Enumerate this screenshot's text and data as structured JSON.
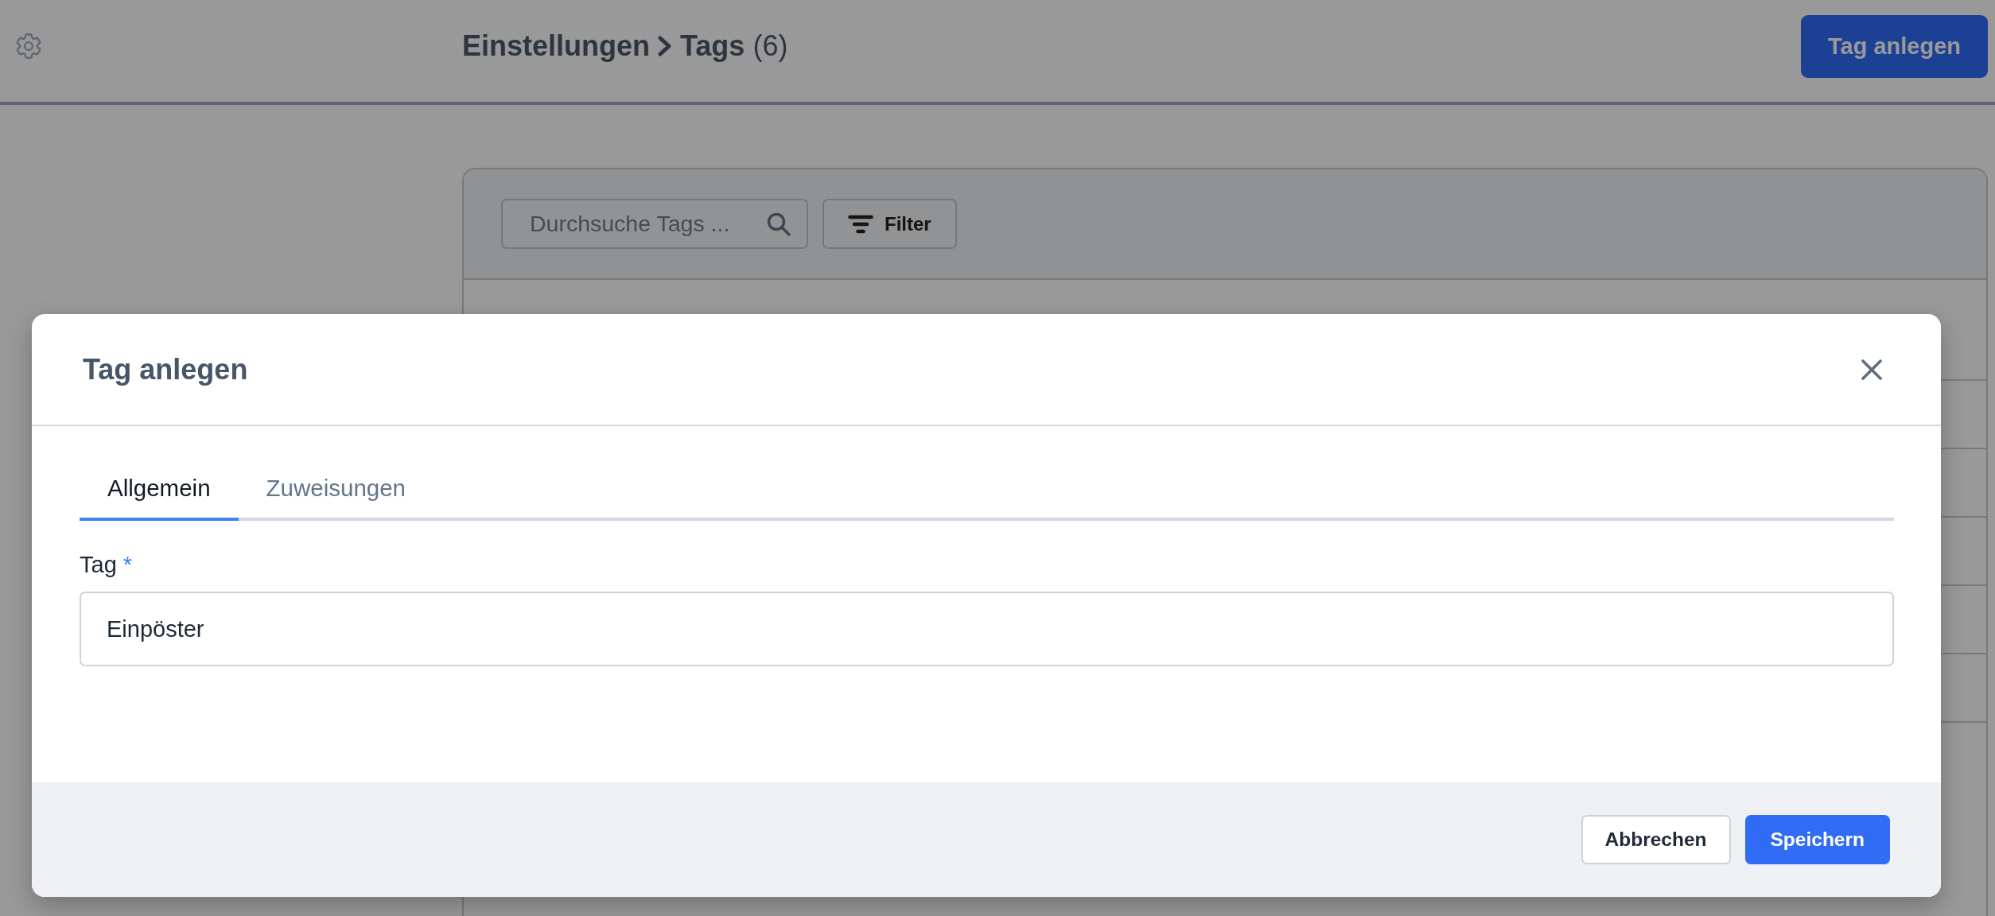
{
  "header": {
    "breadcrumb": [
      {
        "label": "Einstellungen"
      },
      {
        "label": "Tags"
      }
    ],
    "count": "(6)",
    "action_button": "Tag anlegen"
  },
  "toolbar": {
    "search": {
      "placeholder": "Durchsuche Tags ..."
    },
    "filter_button": "Filter"
  },
  "dialog": {
    "title": "Tag anlegen",
    "tabs": [
      {
        "label": "Allgemein",
        "selected": true
      },
      {
        "label": "Zuweisungen",
        "selected": false
      }
    ],
    "fields": [
      {
        "label": "Tag",
        "required_mark": "*",
        "value": "Einpöster"
      }
    ],
    "buttons": [
      {
        "label": "Abbrechen",
        "kind": "secondary"
      },
      {
        "label": "Speichern",
        "kind": "primary"
      }
    ]
  }
}
